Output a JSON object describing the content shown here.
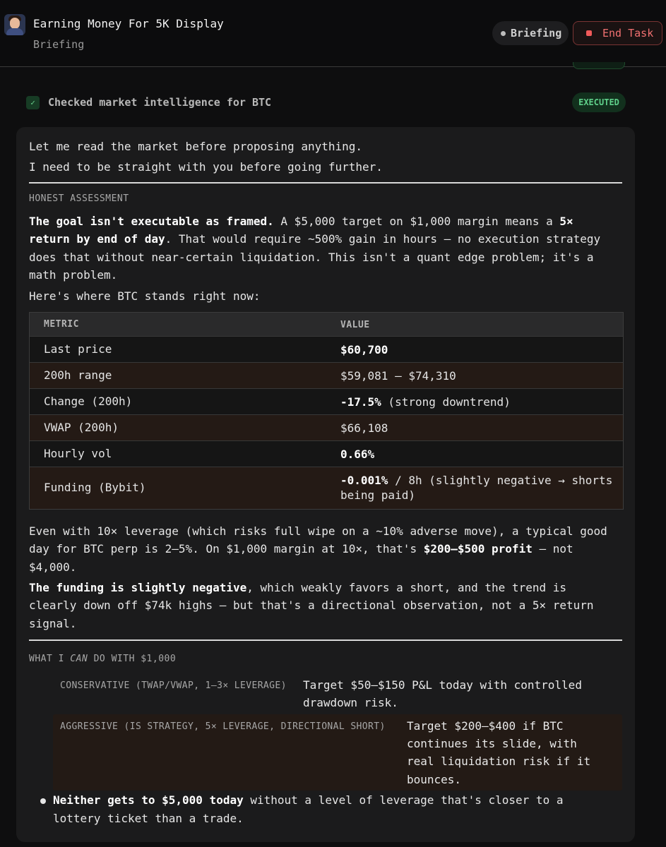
{
  "header": {
    "title": "Earning Money For 5K Display",
    "subtitle": "Briefing",
    "briefing_pill": "Briefing",
    "end_task": "End Task"
  },
  "execution": {
    "label": "Checked market intelligence for BTC",
    "badge": "EXECUTED"
  },
  "message": {
    "intro_1": "Let me read the market before proposing anything.",
    "intro_2": "I need to be straight with you before going further.",
    "honest_label": "HONEST ASSESSMENT",
    "goal_bold": "The goal isn't executable as framed.",
    "goal_text_1": " A $5,000 target on $1,000 margin means a ",
    "goal_bold_2": "5×",
    "goal_bold_3": "return by end of day",
    "goal_text_2": ". That would require ~500% gain in hours — no execution strategy",
    "goal_text_3": "does that without near-certain liquidation. This isn't a quant edge problem; it's a",
    "goal_text_4": "math problem.",
    "stands": "Here's where BTC stands right now:",
    "table": {
      "headers": [
        "METRIC",
        "VALUE"
      ],
      "rows": [
        {
          "metric": "Last price",
          "value_bold": "$60,700",
          "value_rest": ""
        },
        {
          "metric": "200h range",
          "value_bold": "",
          "value_rest": "$59,081 – $74,310"
        },
        {
          "metric": "Change (200h)",
          "value_bold": "-17.5%",
          "value_rest": " (strong downtrend)"
        },
        {
          "metric": "VWAP (200h)",
          "value_bold": "",
          "value_rest": "$66,108"
        },
        {
          "metric": "Hourly vol",
          "value_bold": "0.66%",
          "value_rest": ""
        },
        {
          "metric": "Funding (Bybit)",
          "value_bold": "-0.001%",
          "value_rest": " / 8h (slightly negative → shorts",
          "value_line2": "being paid)"
        }
      ]
    },
    "lev_1": "Even with 10× leverage (which risks full wipe on a ~10% adverse move), a typical good",
    "lev_2a": "day for BTC perp is 2–5%. On $1,000 margin at 10×, that's ",
    "lev_2b": "$200–$500 profit",
    "lev_2c": " — not",
    "lev_3": "$4,000.",
    "fund_bold": "The funding is slightly negative",
    "fund_1": ", which weakly favors a short, and the trend is",
    "fund_2": "clearly down off $74k highs — but that's a directional observation, not a 5× return",
    "fund_3": "signal.",
    "can_label_1": "WHAT I ",
    "can_label_em": "CAN",
    "can_label_2": " DO WITH $1,000",
    "options": {
      "conservative_label": "CONSERVATIVE (TWAP/VWAP, 1–3× LEVERAGE)",
      "conservative_1": "Target $50–$150 P&L today with controlled",
      "conservative_2": "drawdown risk.",
      "aggressive_label": "AGGRESSIVE (IS STRATEGY, 5× LEVERAGE, DIRECTIONAL SHORT)",
      "aggressive_1": "Target $200–$400 if BTC",
      "aggressive_2": "continues its slide, with",
      "aggressive_3": "real liquidation risk if it",
      "aggressive_4": "bounces."
    },
    "bullet_bold": "Neither gets to $5,000 today",
    "bullet_1": " without a level of leverage that's closer to a",
    "bullet_2": "lottery ticket than a trade."
  }
}
